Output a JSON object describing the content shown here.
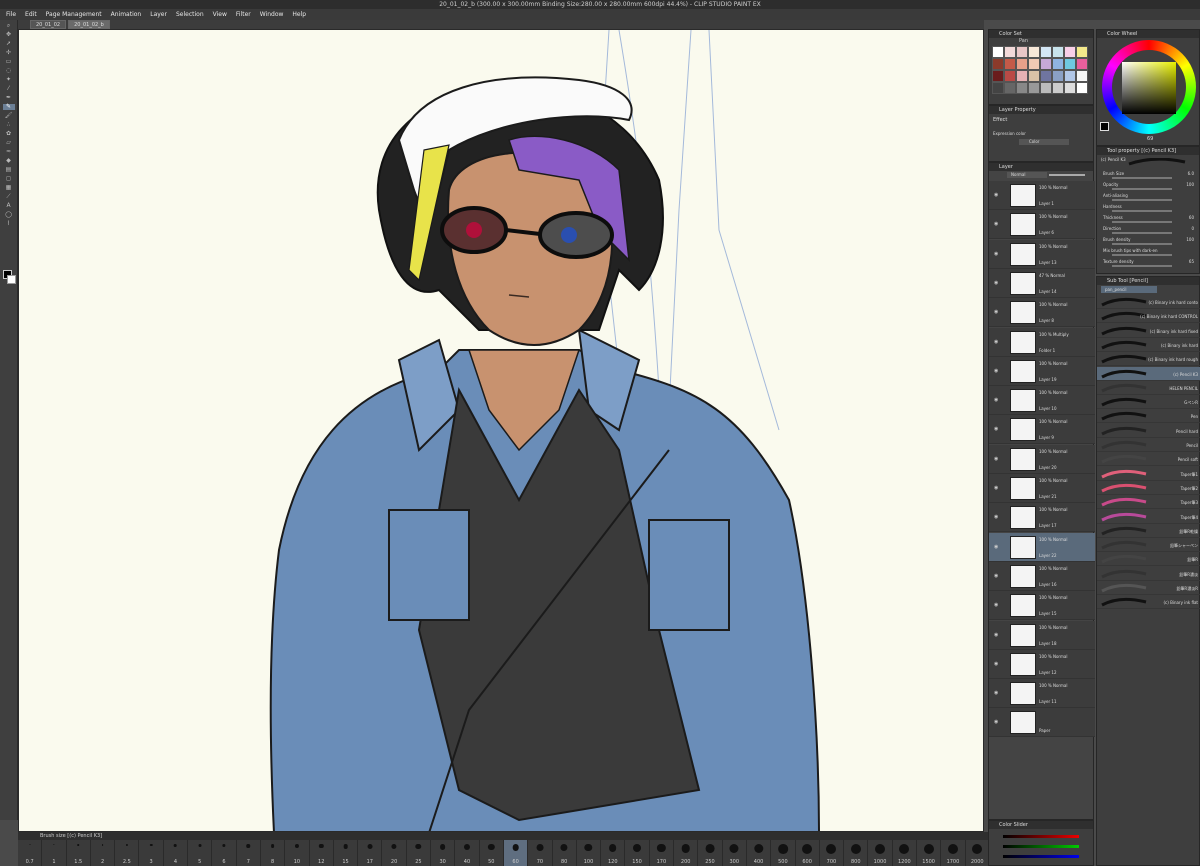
{
  "window": {
    "title": "20_01_02_b (300.00 x 300.00mm Binding Size:280.00 x 280.00mm 600dpi 44.4%) - CLIP STUDIO PAINT EX"
  },
  "menu": [
    "File",
    "Edit",
    "Page Management",
    "Animation",
    "Layer",
    "Selection",
    "View",
    "Filter",
    "Window",
    "Help"
  ],
  "tabs": [
    "20_01_02",
    "20_01_02_b"
  ],
  "panels": {
    "color_set": {
      "title": "Color Set",
      "set_name": "Pan"
    },
    "color_wheel": {
      "title": "Color Wheel",
      "value": "69"
    },
    "layer_property": {
      "title": "Layer Property",
      "effect": "Effect",
      "expression_label": "Expression color",
      "expression_value": "Color"
    },
    "layer": {
      "title": "Layer",
      "blend": "Normal"
    },
    "tool_property": {
      "title": "Tool property [(c) Pencil K3]",
      "brush_name": "(c) Pencil K3"
    },
    "sub_tool": {
      "title": "Sub Tool [Pencil]",
      "group": "pan_pencil"
    },
    "color_slider": {
      "title": "Color Slider"
    }
  },
  "layers": [
    {
      "name": "Layer 1",
      "mode": "100 % Normal"
    },
    {
      "name": "Layer 6",
      "mode": "100 % Normal"
    },
    {
      "name": "Layer 13",
      "mode": "100 % Normal"
    },
    {
      "name": "Layer 14",
      "mode": "47 % Normal"
    },
    {
      "name": "Layer 8",
      "mode": "100 % Normal"
    },
    {
      "name": "Folder 1",
      "mode": "100 % Multiply"
    },
    {
      "name": "Layer 19",
      "mode": "100 % Normal"
    },
    {
      "name": "Layer 10",
      "mode": "100 % Normal"
    },
    {
      "name": "Layer 9",
      "mode": "100 % Normal"
    },
    {
      "name": "Layer 20",
      "mode": "100 % Normal"
    },
    {
      "name": "Layer 21",
      "mode": "100 % Normal"
    },
    {
      "name": "Layer 17",
      "mode": "100 % Normal"
    },
    {
      "name": "Layer 22",
      "mode": "100 % Normal"
    },
    {
      "name": "Layer 16",
      "mode": "100 % Normal"
    },
    {
      "name": "Layer 15",
      "mode": "100 % Normal"
    },
    {
      "name": "Layer 18",
      "mode": "100 % Normal"
    },
    {
      "name": "Layer 12",
      "mode": "100 % Normal"
    },
    {
      "name": "Layer 11",
      "mode": "100 % Normal"
    },
    {
      "name": "Paper",
      "mode": ""
    }
  ],
  "tool_props": [
    {
      "label": "Brush Size",
      "value": "6.0"
    },
    {
      "label": "Opacity",
      "value": "100"
    },
    {
      "label": "Anti-aliasing",
      "value": ""
    },
    {
      "label": "Hardness",
      "value": ""
    },
    {
      "label": "Thickness",
      "value": "60"
    },
    {
      "label": "Direction",
      "value": "0"
    },
    {
      "label": "Brush density",
      "value": "100"
    },
    {
      "label": "Mix brush tips with dark-en",
      "value": ""
    },
    {
      "label": "Texture density",
      "value": "65"
    }
  ],
  "brushes": [
    "(c) Binary ink hard conto",
    "(c) Binary ink hard CONTROL",
    "(c) Binary ink hard fixed",
    "(c) Binary ink hard",
    "(c) Binary ink hard rough",
    "(c) Pencil K3",
    "HELEN PENCIL",
    "GペンR",
    "Pen",
    "Pencil hard",
    "Pencil",
    "Pencil soft",
    "Taper筆1",
    "Taper筆2",
    "Taper筆3",
    "Taper筆4",
    "鉛筆R乾燥",
    "鉛筆シャーペン",
    "鉛筆R",
    "鉛筆R濃淡",
    "鉛筆R濃淡R",
    "(c) Binary ink flat"
  ],
  "brush_size": {
    "label": "Brush size [(c) Pencil K3]",
    "sizes": [
      "0.7",
      "1",
      "1.5",
      "2",
      "2.5",
      "3",
      "4",
      "5",
      "6",
      "7",
      "8",
      "10",
      "12",
      "15",
      "17",
      "20",
      "25",
      "30",
      "40",
      "50",
      "60",
      "70",
      "80",
      "100",
      "120",
      "150",
      "170",
      "200",
      "250",
      "300",
      "400",
      "500",
      "600",
      "700",
      "800",
      "1000",
      "1200",
      "1500",
      "1700",
      "2000"
    ],
    "selected": "60"
  },
  "colors": {
    "accent": "#6b7f96",
    "panel": "#3e3e3e",
    "canvas": "#fafaee",
    "jacket": "#6a8db8",
    "shirt": "#3a3a3a",
    "skin": "#c8926f",
    "hair": "#222222"
  },
  "color_set": [
    "#ffffff",
    "#f2d9d9",
    "#e9c6c6",
    "#f7e8d8",
    "#d3e6f5",
    "#c8e3ec",
    "#f9cfe8",
    "#f4e98b",
    "#8c3a2a",
    "#c35a48",
    "#e8a08a",
    "#f1c9b4",
    "#c6a8d7",
    "#8fb4e2",
    "#6fc9e0",
    "#e85f9c",
    "#6a1c1c",
    "#b94a46",
    "#e7b2b4",
    "#dac2a7",
    "#6f75a0",
    "#8aa0c4",
    "#b1c7e7",
    "#f5f5f5",
    "#444444",
    "#666666",
    "#888888",
    "#999999",
    "#bbbbbb",
    "#cccccc",
    "#dddddd",
    "#ffffff"
  ]
}
